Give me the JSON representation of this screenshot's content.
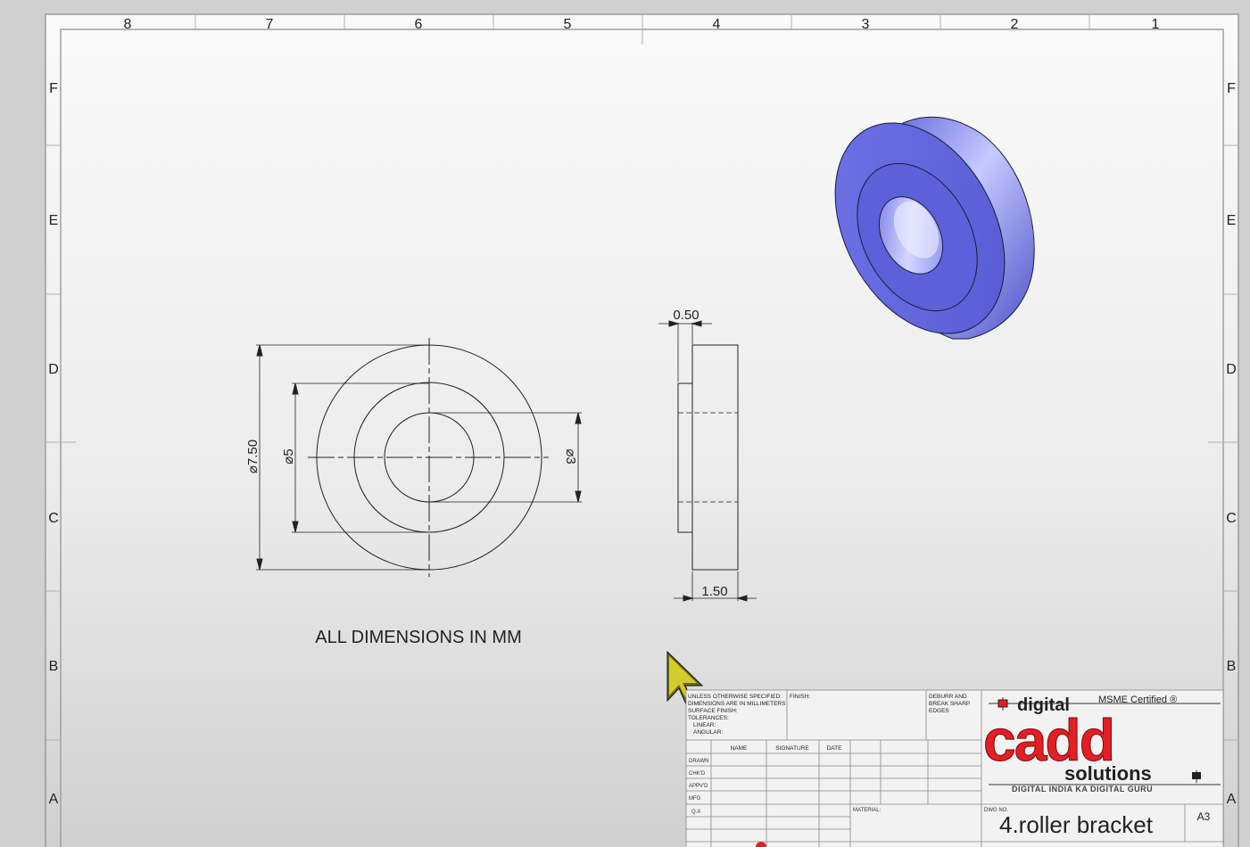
{
  "sheet": {
    "top_zones": [
      "8",
      "7",
      "6",
      "5",
      "4",
      "3",
      "2",
      "1"
    ],
    "side_zones": [
      "F",
      "E",
      "D",
      "C",
      "B",
      "A"
    ]
  },
  "front_view": {
    "dim_outer": "⌀7.50",
    "dim_middle": "⌀5",
    "dim_inner": "⌀3"
  },
  "side_view": {
    "dim_top": "0.50",
    "dim_bottom": "1.50"
  },
  "note": "ALL DIMENSIONS IN MM",
  "title_block": {
    "spec_lines": [
      "UNLESS OTHERWISE SPECIFIED:",
      "DIMENSIONS ARE IN MILLIMETERS",
      "SURFACE FINISH:",
      "TOLERANCES:",
      "LINEAR:",
      "ANGULAR:"
    ],
    "finish_label": "FINISH:",
    "deburr_lines": [
      "DEBURR AND",
      "BREAK SHARP",
      "EDGES"
    ],
    "col_headers": [
      "NAME",
      "SIGNATURE",
      "DATE"
    ],
    "row_labels": [
      "DRAWN",
      "CHK'D",
      "APPV'D",
      "MFG",
      "Q.A"
    ],
    "material_label": "MATERIAL:",
    "dwg_no_label": "DWG NO.",
    "drawing_title": "4.roller bracket",
    "sheet_size": "A3"
  },
  "logo": {
    "top_word": "digital",
    "certified": "MSME Certified ®",
    "main_word": "cadd",
    "sub_word": "solutions",
    "tagline": "DIGITAL INDIA KA DIGITAL GURU"
  },
  "colors": {
    "part_face": "#7a80ee",
    "part_dark": "#4b50c8",
    "logo_red": "#e31e24"
  }
}
